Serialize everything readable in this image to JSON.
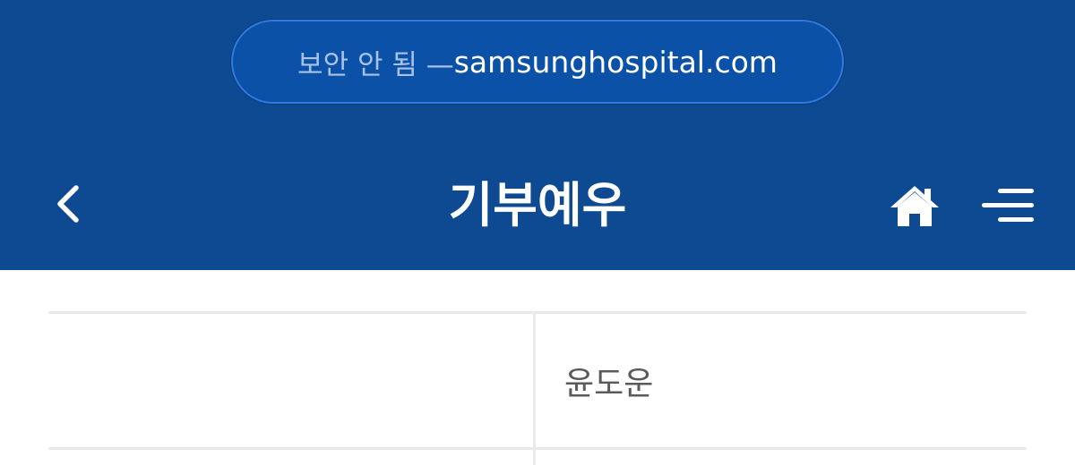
{
  "browser": {
    "url_prefix": "보안 안 됨 — ",
    "url_domain": "samsunghospital.com"
  },
  "nav": {
    "title": "기부예우",
    "back_icon": "chevron-left-icon",
    "home_icon": "home-icon",
    "menu_icon": "menu-icon"
  },
  "content": {
    "rows": [
      {
        "label": "",
        "value": "윤도운"
      }
    ]
  },
  "colors": {
    "header_bg": "#0e4a92",
    "pill_bg": "#0b51a8",
    "pill_border": "#2f7be0",
    "divider": "#e9e9e9",
    "value_text": "#5a5a5a"
  }
}
